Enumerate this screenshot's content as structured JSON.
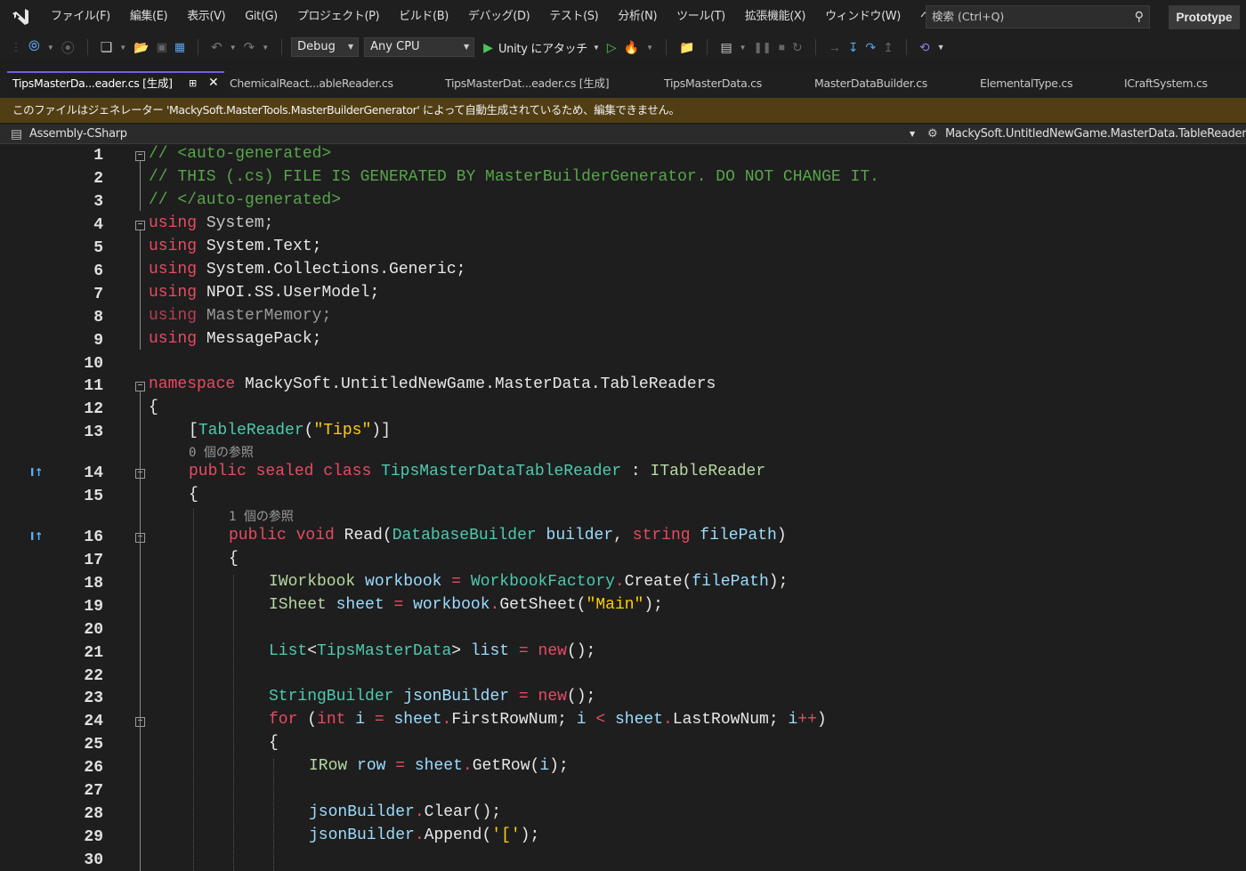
{
  "menu": {
    "items": [
      "ファイル(F)",
      "編集(E)",
      "表示(V)",
      "Git(G)",
      "プロジェクト(P)",
      "ビルド(B)",
      "デバッグ(D)",
      "テスト(S)",
      "分析(N)",
      "ツール(T)",
      "拡張機能(X)",
      "ウィンドウ(W)",
      "ヘルプ(H)"
    ],
    "search_placeholder": "検索 (Ctrl+Q)",
    "profile": "Prototype"
  },
  "toolbar": {
    "config": "Debug",
    "platform": "Any CPU",
    "attach_label": "Unity にアタッチ"
  },
  "tabs": [
    {
      "label": "TipsMasterDa...eader.cs [生成]"
    },
    {
      "label": "ChemicalReact...ableReader.cs"
    },
    {
      "label": "TipsMasterDat...eader.cs [生成]"
    },
    {
      "label": "TipsMasterData.cs"
    },
    {
      "label": "MasterDataBuilder.cs"
    },
    {
      "label": "ElementalType.cs"
    },
    {
      "label": "ICraftSystem.cs"
    }
  ],
  "infobar": {
    "message": "このファイルはジェネレーター 'MackySoft.MasterTools.MasterBuilderGenerator' によって自動生成されているため、編集できません。"
  },
  "navbar": {
    "project": "Assembly-CSharp",
    "type": "MackySoft.UntitledNewGame.MasterData.TableReaders."
  },
  "editor": {
    "lines": [
      "1",
      "2",
      "3",
      "4",
      "5",
      "6",
      "7",
      "8",
      "9",
      "10",
      "11",
      "12",
      "13",
      "14",
      "15",
      "16",
      "17",
      "18",
      "19",
      "20",
      "21",
      "22",
      "23",
      "24",
      "25",
      "26",
      "27",
      "28",
      "29",
      "30"
    ],
    "ref_label": "0 個の参照",
    "ref_label_2": "1 個の参照",
    "code": {
      "l1": "// <auto-generated>",
      "l2": "// THIS (.cs) FILE IS GENERATED BY MasterBuilderGenerator. DO NOT CHANGE IT.",
      "l3": "// </auto-generated>",
      "kw_using": "using",
      "u1": " System;",
      "u2": " System.Text;",
      "u3": " System.Collections.Generic;",
      "u4": " NPOI.SS.UserModel;",
      "u5": " MasterMemory;",
      "u6": " MessagePack;",
      "kw_namespace": "namespace",
      "ns_name": " MackySoft.UntitledNewGame.MasterData.TableReaders",
      "brace_open": "{",
      "attr_open": "[",
      "attr_name": "TableReader",
      "attr_paren": "(",
      "attr_str": "\"Tips\"",
      "attr_close": ")]",
      "kw_public": "public",
      "kw_sealed": "sealed",
      "kw_class": "class",
      "class_name": "TipsMasterDataTableReader",
      "colon": " : ",
      "iface": "ITableReader",
      "kw_void": "void",
      "m_read": "Read",
      "p_type1": "DatabaseBuilder",
      "p_name1": "builder",
      "kw_string": "string",
      "p_name2": "filePath",
      "t_iworkbook": "IWorkbook",
      "v_workbook": "workbook",
      "t_factory": "WorkbookFactory",
      "m_create": "Create",
      "v_filepath": "filePath",
      "t_isheet": "ISheet",
      "v_sheet": "sheet",
      "m_getsheet": "GetSheet",
      "s_main": "\"Main\"",
      "t_list": "List",
      "t_tips": "TipsMasterData",
      "v_list": "list",
      "kw_new": "new",
      "t_sb": "StringBuilder",
      "v_json": "jsonBuilder",
      "kw_for": "for",
      "kw_int": "int",
      "v_i": "i",
      "m_first": "FirstRowNum",
      "m_last": "LastRowNum",
      "t_irow": "IRow",
      "v_row": "row",
      "m_getrow": "GetRow",
      "m_clear": "Clear",
      "m_append": "Append",
      "s_bracket": "'['"
    }
  }
}
